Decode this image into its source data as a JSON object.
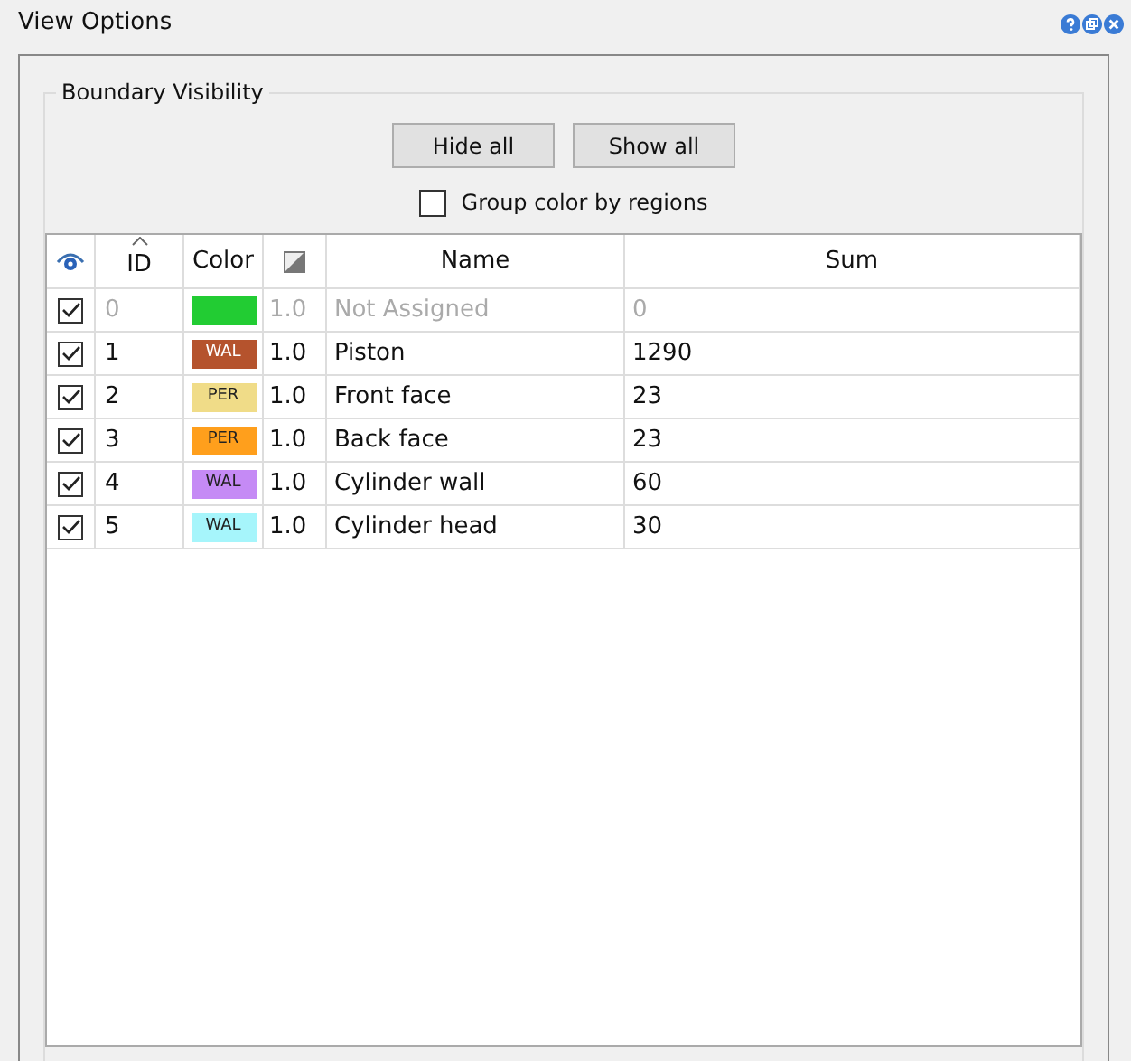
{
  "window": {
    "title": "View Options"
  },
  "group": {
    "title": "Boundary Visibility"
  },
  "buttons": [
    "Hide all",
    "Show all"
  ],
  "group_color_by_regions": {
    "label": "Group color by regions",
    "checked": false
  },
  "table": {
    "columns": [
      "ID",
      "Color",
      "Name",
      "Sum"
    ],
    "rows": [
      {
        "visible": true,
        "disabled": true,
        "id": "0",
        "color": "#22cc33",
        "tag": "",
        "opacity": "1.0",
        "name": "Not Assigned",
        "sum": "0"
      },
      {
        "visible": true,
        "disabled": false,
        "id": "1",
        "color": "#b5532d",
        "tag": "WAL",
        "opacity": "1.0",
        "name": "Piston",
        "sum": "1290"
      },
      {
        "visible": true,
        "disabled": false,
        "id": "2",
        "color": "#f0dc88",
        "tag": "PER",
        "opacity": "1.0",
        "name": "Front face",
        "sum": "23"
      },
      {
        "visible": true,
        "disabled": false,
        "id": "3",
        "color": "#ff9f1c",
        "tag": "PER",
        "opacity": "1.0",
        "name": "Back face",
        "sum": "23"
      },
      {
        "visible": true,
        "disabled": false,
        "id": "4",
        "color": "#c58af5",
        "tag": "WAL",
        "opacity": "1.0",
        "name": "Cylinder wall",
        "sum": "60"
      },
      {
        "visible": true,
        "disabled": false,
        "id": "5",
        "color": "#a6f5fb",
        "tag": "WAL",
        "opacity": "1.0",
        "name": "Cylinder head",
        "sum": "30"
      }
    ]
  }
}
